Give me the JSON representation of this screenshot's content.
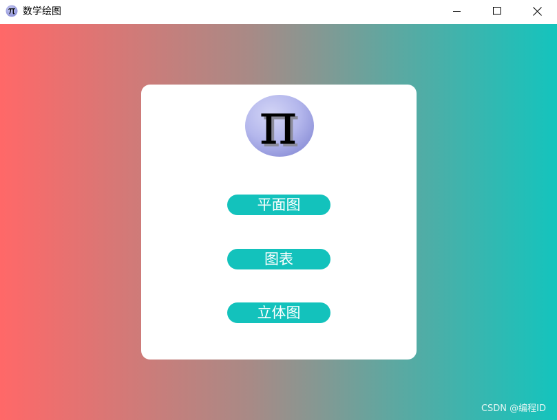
{
  "window": {
    "title": "数学绘图",
    "app_icon": "pi-icon"
  },
  "titlebar_controls": {
    "minimize_icon": "minimize-icon",
    "maximize_icon": "maximize-icon",
    "close_icon": "close-icon"
  },
  "card": {
    "logo_icon": "pi-logo-icon",
    "logo_glyph": "π",
    "buttons": [
      {
        "label": "平面图"
      },
      {
        "label": "图表"
      },
      {
        "label": "立体图"
      }
    ]
  },
  "watermark": "CSDN @编程ID",
  "colors": {
    "gradient_left": "#ff6868",
    "gradient_right": "#14c4bd",
    "button_bg": "#13c2bc",
    "button_text": "#ffffff",
    "card_bg": "#ffffff"
  }
}
